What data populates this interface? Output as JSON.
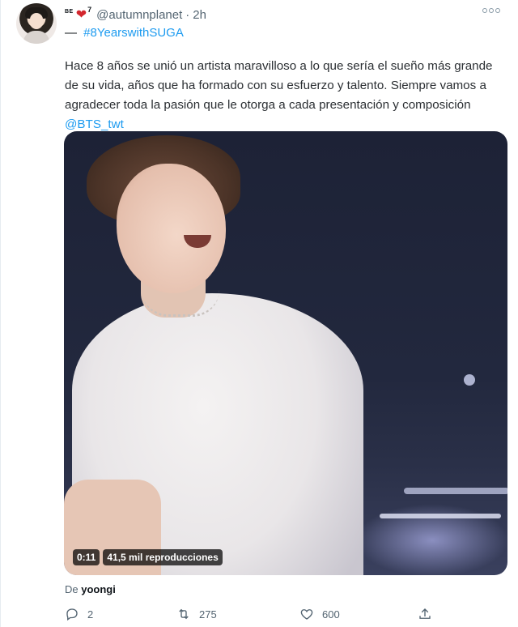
{
  "header": {
    "display_name_prefix": "BE",
    "display_name_suffix": "7",
    "handle": "@autumnplanet",
    "separator": "·",
    "time": "2h"
  },
  "tweet": {
    "hash_prefix": "—",
    "hashtag": "#8YearswithSUGA",
    "text": "Hace 8 años se unió un artista maravilloso a lo que sería el sueño más grande de su vida, años que ha formado con su esfuerzo y talento. Siempre vamos a agradecer toda la pasión que le otorga a cada presentación y composición ",
    "mention": "@BTS_twt"
  },
  "media": {
    "duration": "0:11",
    "views": "41,5 mil reproducciones",
    "source_prefix": "De",
    "source_user": "yoongi"
  },
  "actions": {
    "replies": "2",
    "retweets": "275",
    "likes": "600"
  },
  "icons": {
    "heart_emoji_color": "#d3272e",
    "link_color": "#1d9bf0"
  }
}
